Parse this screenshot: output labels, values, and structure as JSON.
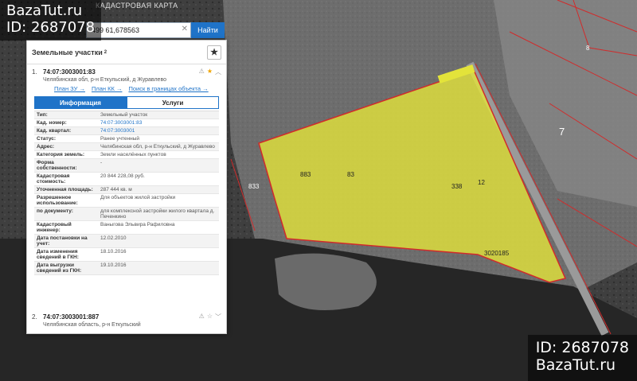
{
  "watermark": {
    "site": "BazaTut.ru",
    "id": "ID: 2687078"
  },
  "header": {
    "title": "КАДАСТРОВАЯ КАРТА"
  },
  "search": {
    "value": "499 61,678563",
    "button_label": "Найти",
    "clear_icon": "close-icon"
  },
  "panel": {
    "title": "Земельные участки",
    "count": "2",
    "star_icon": "star-icon"
  },
  "results": [
    {
      "number": "1.",
      "cadastral": "74:07:3003001:83",
      "address": "Челябинская обл, р-н Еткульский, д Журавлево",
      "links": [
        "План ЗУ →",
        "План КК →",
        "Поиск в границах объекта →"
      ],
      "tabs": [
        "Информация",
        "Услуги"
      ],
      "info": [
        {
          "k": "Тип:",
          "v": "Земельный участок"
        },
        {
          "k": "Кад. номер:",
          "v": "74:07:3003001:83"
        },
        {
          "k": "Кад. квартал:",
          "v": "74:07:3003001"
        },
        {
          "k": "Статус:",
          "v": "Ранее учтенный"
        },
        {
          "k": "Адрес:",
          "v": "Челябинская обл, р-н Еткульский, д Журавлево"
        },
        {
          "k": "Категория земель:",
          "v": "Земли населённых пунктов"
        },
        {
          "k": "Форма собственности:",
          "v": "-"
        },
        {
          "k": "Кадастровая стоимость:",
          "v": "20 844 228,08 руб."
        },
        {
          "k": "Уточненная площадь:",
          "v": "287 444 кв. м"
        },
        {
          "k": "Разрешенное использование:",
          "v": "Для объектов жилой застройки"
        },
        {
          "k": "по документу:",
          "v": "для комплексной застройки жилого квартала д. Печенкино"
        },
        {
          "k": "Кадастровый инженер:",
          "v": "Ваныгова Эльвира Рафиловна"
        },
        {
          "k": "Дата постановки на учет:",
          "v": "12.02.2010"
        },
        {
          "k": "Дата изменения сведений в ГКН:",
          "v": "18.10.2016"
        },
        {
          "k": "Дата выгрузки сведений из ГКН:",
          "v": "19.10.2016"
        }
      ]
    },
    {
      "number": "2.",
      "cadastral": "74:07:3003001:887",
      "address": "Челябинская область, р-н Еткульский"
    }
  ],
  "map": {
    "parcel_color": "#e3e33a",
    "boundary_color": "#d12b2b",
    "labels": [
      {
        "text": "8"
      },
      {
        "text": "7"
      },
      {
        "text": "833"
      },
      {
        "text": "3020185"
      },
      {
        "text": "883"
      },
      {
        "text": "83"
      },
      {
        "text": "338"
      },
      {
        "text": "12"
      }
    ]
  }
}
